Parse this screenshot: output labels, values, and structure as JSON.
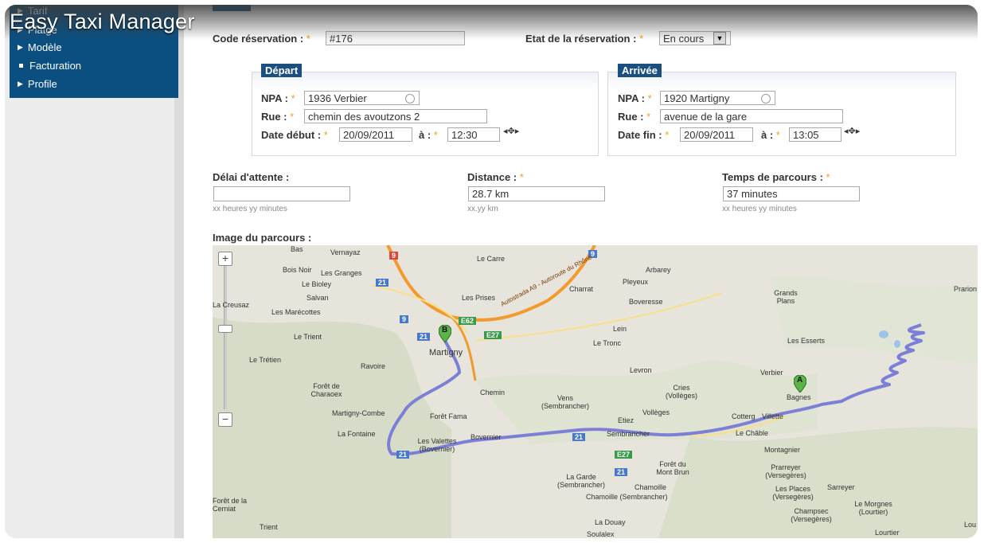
{
  "app": {
    "title": "Easy Taxi Manager"
  },
  "sidebar": {
    "items": [
      {
        "label": "Tarif"
      },
      {
        "label": "Platge"
      },
      {
        "label": "Modèle"
      },
      {
        "label": "Facturation"
      },
      {
        "label": "Profile"
      }
    ]
  },
  "form": {
    "code_label": "Code réservation :",
    "code_value": "#176",
    "etat_label": "Etat de la réservation :",
    "etat_value": "En cours",
    "required_mark": "*",
    "depart": {
      "title": "Départ",
      "npa_label": "NPA :",
      "npa_value": "1936 Verbier",
      "rue_label": "Rue :",
      "rue_value": "chemin des avoutzons 2",
      "date_label": "Date début :",
      "date_value": "20/09/2011",
      "time_label": "à :",
      "time_value": "12:30"
    },
    "arrivee": {
      "title": "Arrivée",
      "npa_label": "NPA :",
      "npa_value": "1920 Martigny",
      "rue_label": "Rue :",
      "rue_value": "avenue de la gare",
      "date_label": "Date fin :",
      "date_value": "20/09/2011",
      "time_label": "à :",
      "time_value": "13:05"
    },
    "delai": {
      "label": "Délai d'attente :",
      "value": "",
      "hint": "xx heures yy minutes"
    },
    "distance": {
      "label": "Distance :",
      "value": "28.7 km",
      "hint": "xx.yy km"
    },
    "temps": {
      "label": "Temps de parcours :",
      "value": "37 minutes",
      "hint": "xx heures yy minutes"
    },
    "image_label": "Image du parcours :"
  },
  "map": {
    "zoom_in": "+",
    "zoom_out": "−",
    "marker_a": "A",
    "marker_b": "B",
    "places": [
      "Bas",
      "Vernayaz",
      "Le Carre",
      "Arbarey",
      "Bois Noir",
      "Les Granges",
      "Le Bioley",
      "Salvan",
      "Charrat",
      "Pleyeux",
      "Boveresse",
      "Les Prises",
      "La Creusaz",
      "Les Marécottes",
      "Le Trient",
      "Martigny",
      "Lein",
      "Le Tronc",
      "Grands Plans",
      "Prarion",
      "Les Esserts",
      "Le Trétien",
      "Ravoire",
      "Levron",
      "Forêt de Charaoex",
      "Chemin",
      "Vens (Sembrancher)",
      "Cries (Vollèges)",
      "Verbier",
      "Bagnes",
      "Vollèges",
      "Martigny-Combe",
      "Forêt Fama",
      "Etiez",
      "Cotterg",
      "Villette",
      "La Fontaine",
      "Les Valettes (Bovernier)",
      "Bovernier",
      "Sembrancher",
      "Le Châble",
      "Montagnier",
      "Forêt du Mont Brun",
      "Prarreyer (Versegères)",
      "La Garde (Sembrancher)",
      "Chamoille",
      "Chamoille (Sembrancher)",
      "Les Places (Versegères)",
      "Sarreyer",
      "Champsec (Versegères)",
      "Le Morgnes (Lourtier)",
      "Forêt de la Cerniat",
      "Trient",
      "La Douay",
      "Soulalex",
      "Lourtier",
      "Lou"
    ],
    "roads": [
      "9",
      "9",
      "21",
      "9",
      "E62",
      "21",
      "E27",
      "21",
      "21",
      "E27",
      "21"
    ],
    "highway_label": "Autostrada A9 - Autoroute du Rhône",
    "route_color": "#7b7fd6",
    "highway_color": "#f29a2e"
  }
}
